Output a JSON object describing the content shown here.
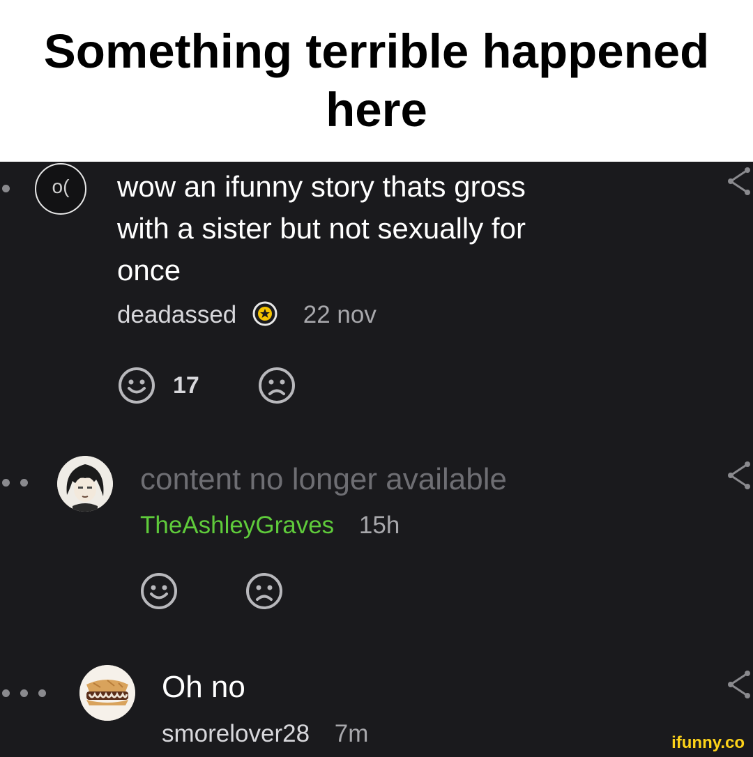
{
  "header": {
    "title_line1": "Something terrible happened",
    "title_line2": "here"
  },
  "comments": [
    {
      "text_line1": "wow an ifunny story thats gross",
      "text_line2": "with a sister but not sexually for",
      "text_line3": "once",
      "username": "deadassed",
      "time": "22 nov",
      "smile_count": "17",
      "avatar_text": "o(",
      "depth": 1
    },
    {
      "text": "content no longer available",
      "username": "TheAshleyGraves",
      "time": "15h",
      "depth": 2,
      "username_color": "#5fcb3b"
    },
    {
      "text": "Oh no",
      "username": "smorelover28",
      "time": "7m",
      "depth": 3
    }
  ],
  "watermark": "ifunny.co",
  "colors": {
    "background": "#1a1a1d",
    "text": "#ffffff",
    "meta": "#b8b8bc",
    "muted": "#6e6e73",
    "badge_gold": "#f5c400",
    "green_username": "#5fcb3b"
  }
}
